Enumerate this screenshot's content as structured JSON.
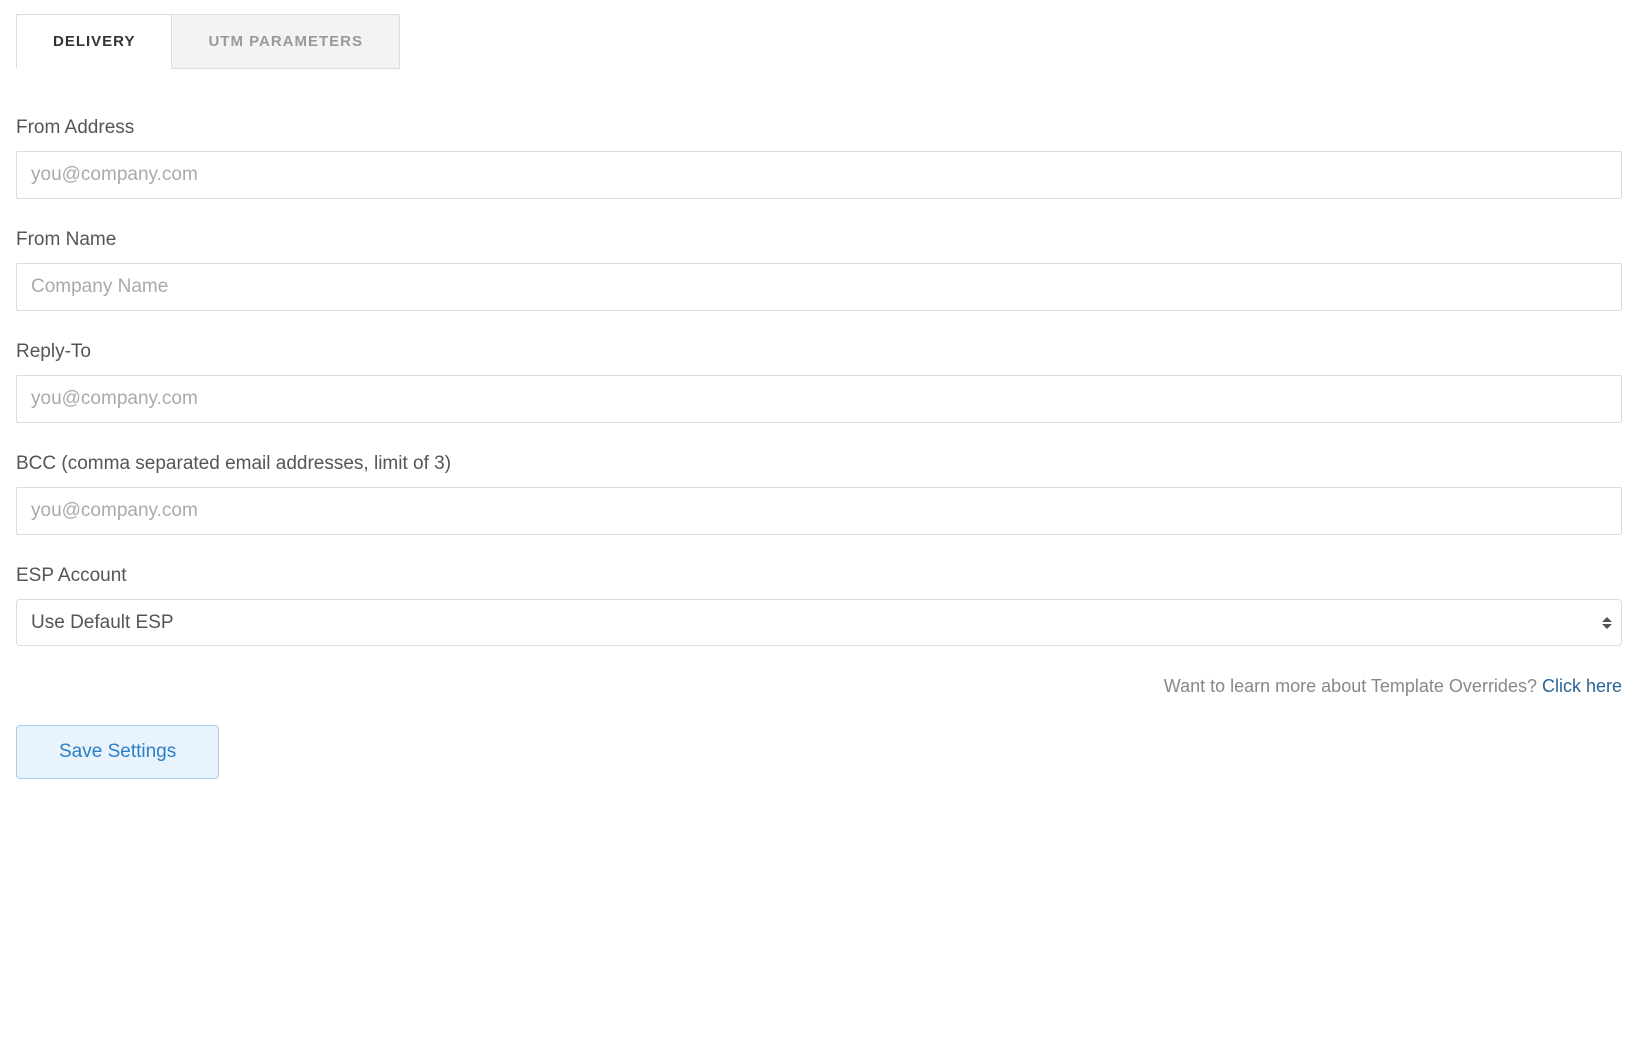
{
  "tabs": {
    "delivery": "DELIVERY",
    "utm": "UTM PARAMETERS"
  },
  "form": {
    "from_address": {
      "label": "From Address",
      "placeholder": "you@company.com",
      "value": ""
    },
    "from_name": {
      "label": "From Name",
      "placeholder": "Company Name",
      "value": ""
    },
    "reply_to": {
      "label": "Reply-To",
      "placeholder": "you@company.com",
      "value": ""
    },
    "bcc": {
      "label": "BCC (comma separated email addresses, limit of 3)",
      "placeholder": "you@company.com",
      "value": ""
    },
    "esp_account": {
      "label": "ESP Account",
      "selected": "Use Default ESP"
    }
  },
  "help": {
    "text": "Want to learn more about Template Overrides? ",
    "link": "Click here"
  },
  "save_button": "Save Settings"
}
